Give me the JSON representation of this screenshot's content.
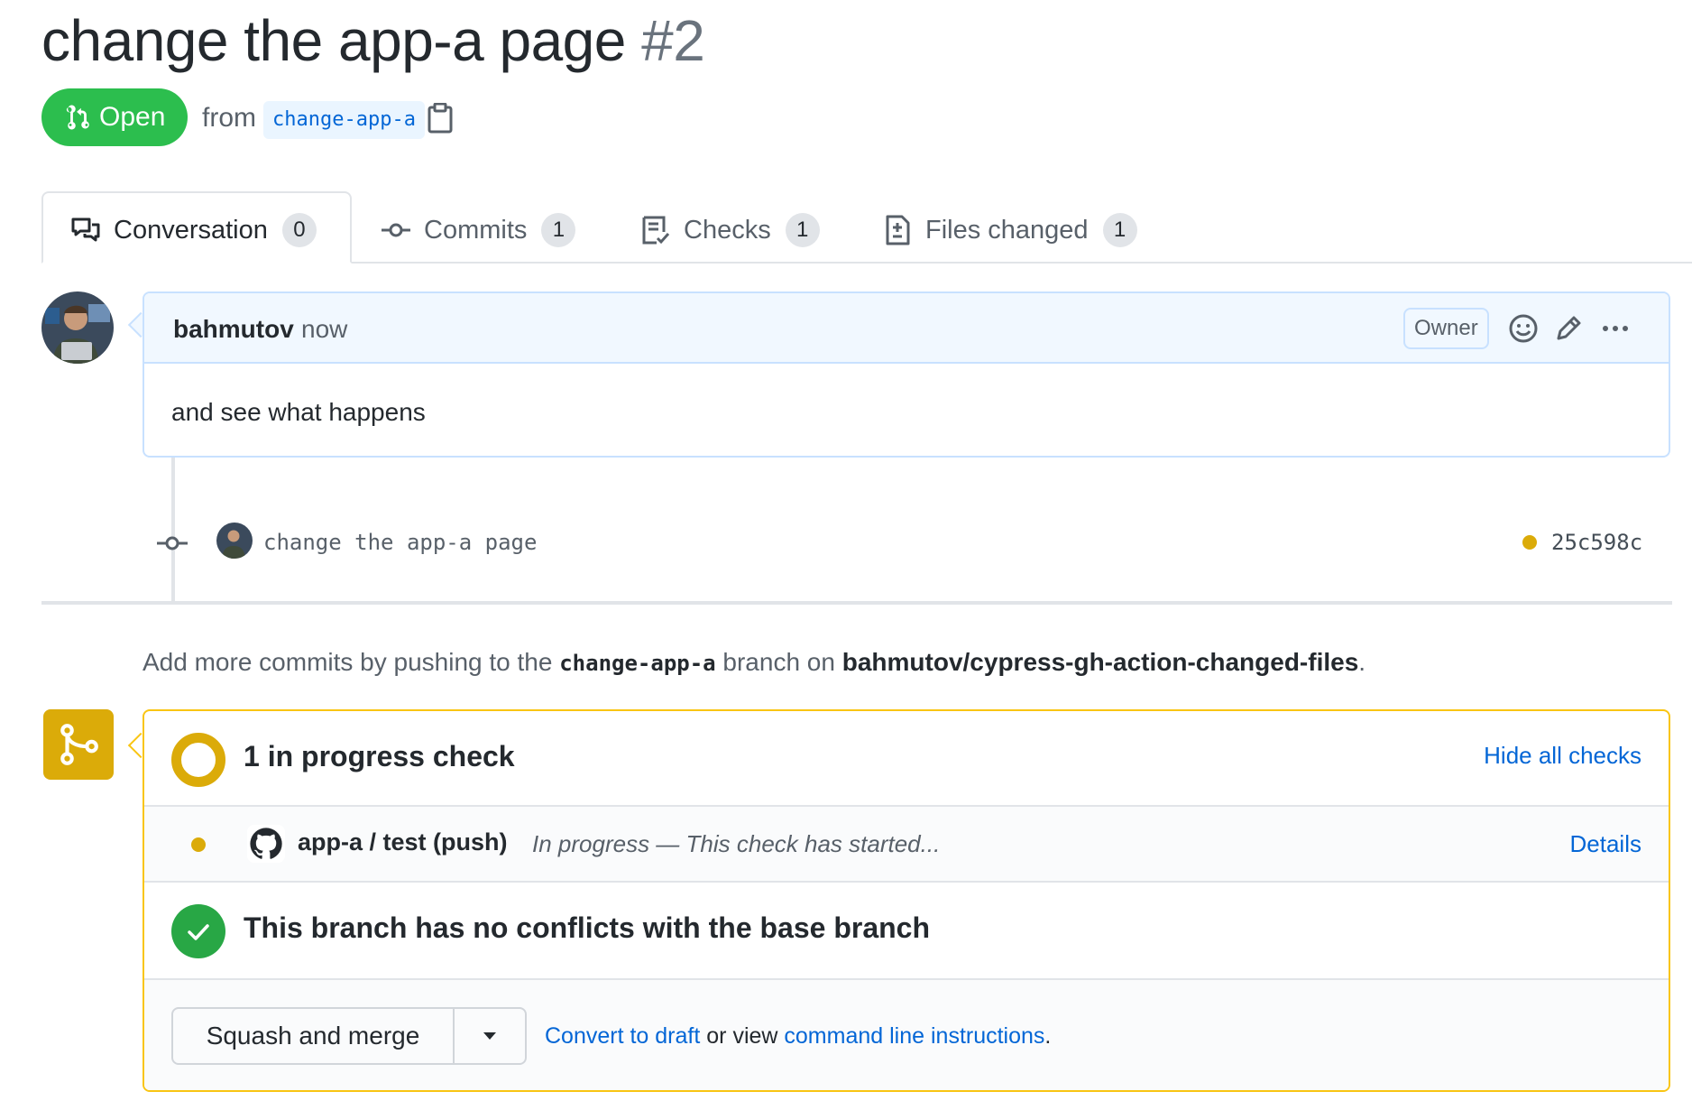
{
  "pr": {
    "title": "change the app-a page",
    "number": "#2",
    "state": "Open",
    "from_label": "from",
    "branch": "change-app-a"
  },
  "tabs": [
    {
      "label": "Conversation",
      "count": "0",
      "icon": "comment-discussion-icon"
    },
    {
      "label": "Commits",
      "count": "1",
      "icon": "git-commit-icon"
    },
    {
      "label": "Checks",
      "count": "1",
      "icon": "checklist-icon"
    },
    {
      "label": "Files changed",
      "count": "1",
      "icon": "file-diff-icon"
    }
  ],
  "comment": {
    "author": "bahmutov",
    "time": "now",
    "role": "Owner",
    "body": "and see what happens"
  },
  "commit": {
    "message": "change the app-a page",
    "sha": "25c598c",
    "status_color": "#dbab09"
  },
  "push_hint": {
    "prefix": "Add more commits by pushing to the",
    "branch": "change-app-a",
    "middle": "branch on",
    "repo": "bahmutov/cypress-gh-action-changed-files",
    "suffix": "."
  },
  "merge": {
    "checks_title": "1 in progress check",
    "hide_link": "Hide all checks",
    "check": {
      "name": "app-a / test (push)",
      "description": "In progress — This check has started...",
      "details_link": "Details"
    },
    "conflicts_title": "This branch has no conflicts with the base branch",
    "squash_label": "Squash and merge",
    "convert_link": "Convert to draft",
    "or_view": "or view",
    "cli_link": "command line instructions",
    "period": "."
  },
  "colors": {
    "open_green": "#2cbe4e",
    "pending_yellow": "#dbab09",
    "success_green": "#28a745",
    "link_blue": "#0366d6"
  }
}
